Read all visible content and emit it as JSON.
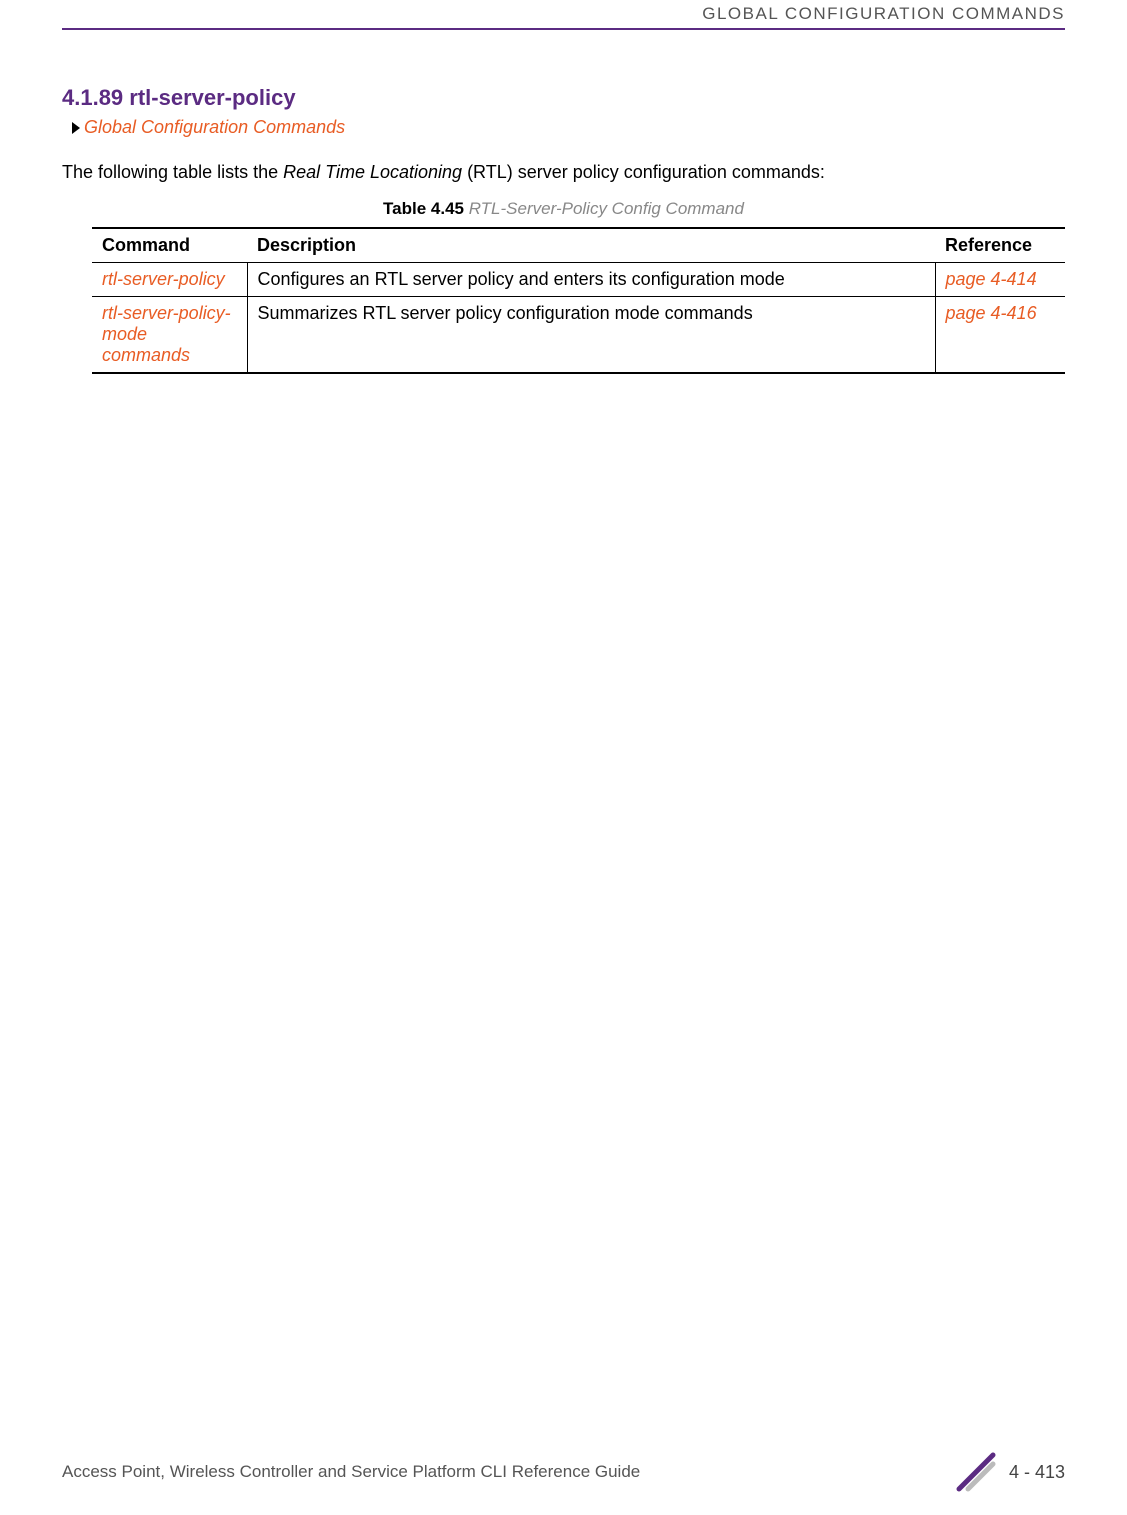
{
  "header": {
    "running_title": "GLOBAL CONFIGURATION COMMANDS"
  },
  "section": {
    "heading": "4.1.89 rtl-server-policy",
    "breadcrumb": "Global Configuration Commands",
    "intro_prefix": "The following table lists the ",
    "intro_italic": "Real Time Locationing",
    "intro_suffix": " (RTL) server policy configuration commands:"
  },
  "table": {
    "caption_label": "Table 4.45",
    "caption_title": "  RTL-Server-Policy Config Command",
    "headers": {
      "command": "Command",
      "description": "Description",
      "reference": "Reference"
    },
    "rows": [
      {
        "command": "rtl-server-policy",
        "description": "Configures an RTL server policy and enters its configuration mode",
        "reference": "page 4-414"
      },
      {
        "command": "rtl-server-policy-mode commands",
        "description": "Summarizes RTL server policy configuration mode commands",
        "reference": "page 4-416"
      }
    ]
  },
  "footer": {
    "guide_title": "Access Point, Wireless Controller and Service Platform CLI Reference Guide",
    "page_number": "4 - 413"
  },
  "colors": {
    "brand_purple": "#5b2b82",
    "link_orange": "#e85c24"
  }
}
